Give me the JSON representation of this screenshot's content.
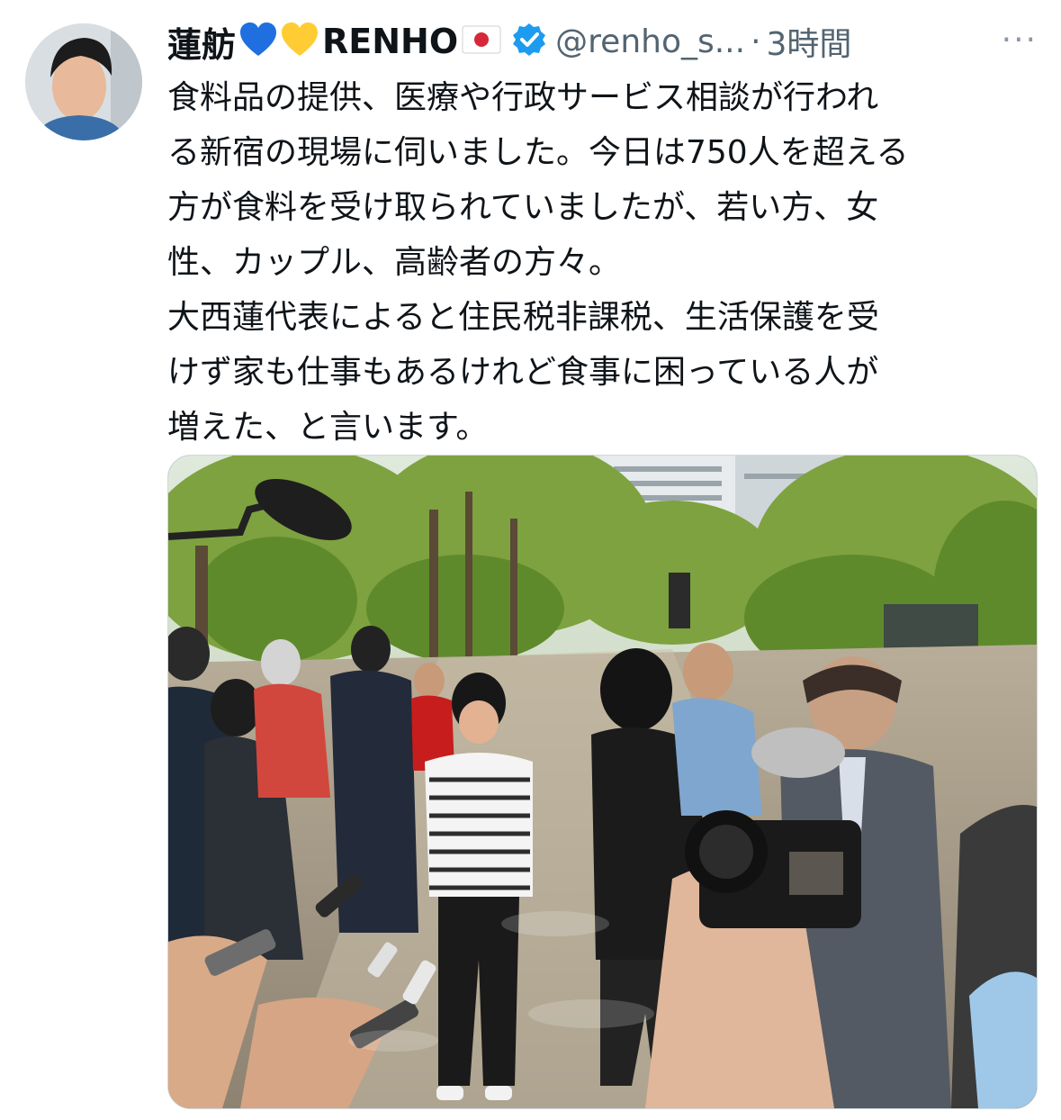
{
  "tweet": {
    "display_name": "蓮舫",
    "name_suffix": "RENHO",
    "handle": "@renho_s...",
    "separator": "·",
    "time_ago": "3時間",
    "more_label": "···",
    "text": "食料品の提供、医療や行政サービス相談が行われ\nる新宿の現場に伺いました。今日は750人を超える\n方が食料を受け取られていましたが、若い方、女\n性、カップル、高齢者の方々。\n大西蓮代表によると住民税非課税、生活保護を受\nけず家も仕事もあるけれど食事に困っている人が\n増えた、と言います。"
  },
  "icons": {
    "heart_blue": "blue-heart-icon",
    "heart_yellow": "yellow-heart-icon",
    "flag": "japan-flag-icon",
    "verified": "verified-badge-icon"
  },
  "colors": {
    "verified_blue": "#1d9bf0",
    "heart_blue": "#1f6fe0",
    "heart_yellow": "#ffcc33",
    "secondary_text": "#536471"
  }
}
